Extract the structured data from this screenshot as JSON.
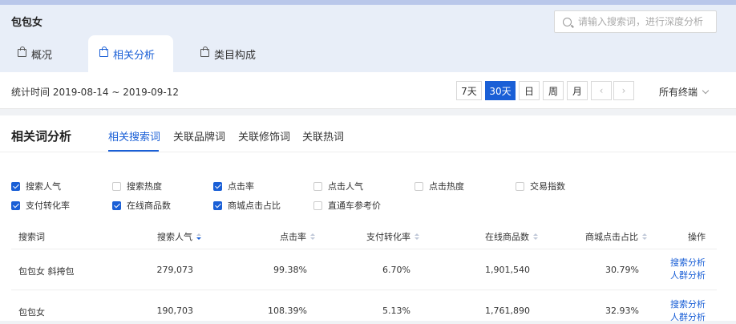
{
  "header": {
    "keyword": "包包女",
    "search_placeholder": "请输入搜索词，进行深度分析"
  },
  "tabs": [
    {
      "label": "概况",
      "icon": "bag-icon",
      "active": false
    },
    {
      "label": "相关分析",
      "icon": "bag-icon",
      "active": true
    },
    {
      "label": "类目构成",
      "icon": "bag-icon",
      "active": false
    }
  ],
  "datebar": {
    "stat_time": "统计时间 2019-08-14 ~ 2019-09-12",
    "ranges": [
      "7天",
      "30天",
      "日",
      "周",
      "月"
    ],
    "selected_range": "30天",
    "prev_icon": "chevron-left-icon",
    "next_icon": "chevron-right-icon",
    "terminal": "所有终端"
  },
  "panel": {
    "title": "相关词分析",
    "subtabs": [
      "相关搜索词",
      "关联品牌词",
      "关联修饰词",
      "关联热词"
    ],
    "active_subtab": "相关搜索词"
  },
  "metrics": [
    {
      "label": "搜索人气",
      "checked": true
    },
    {
      "label": "搜索热度",
      "checked": false
    },
    {
      "label": "点击率",
      "checked": true
    },
    {
      "label": "点击人气",
      "checked": false
    },
    {
      "label": "点击热度",
      "checked": false
    },
    {
      "label": "交易指数",
      "checked": false
    },
    {
      "label": "支付转化率",
      "checked": true
    },
    {
      "label": "在线商品数",
      "checked": true
    },
    {
      "label": "商城点击占比",
      "checked": true
    },
    {
      "label": "直通车参考价",
      "checked": false
    }
  ],
  "table": {
    "columns": [
      "搜索词",
      "搜索人气",
      "点击率",
      "支付转化率",
      "在线商品数",
      "商城点击占比",
      "操作"
    ],
    "rows": [
      {
        "term": "包包女 斜挎包",
        "popularity": "279,073",
        "ctr": "99.38%",
        "conversion": "6.70%",
        "items": "1,901,540",
        "mall_share": "30.79%",
        "actions": [
          "搜索分析",
          "人群分析"
        ]
      },
      {
        "term": "包包女",
        "popularity": "190,703",
        "ctr": "108.39%",
        "conversion": "5.13%",
        "items": "1,761,890",
        "mall_share": "32.93%",
        "actions": [
          "搜索分析",
          "人群分析"
        ]
      }
    ]
  },
  "colors": {
    "accent": "#1a5fd6",
    "header_bg": "#e8eef8"
  }
}
